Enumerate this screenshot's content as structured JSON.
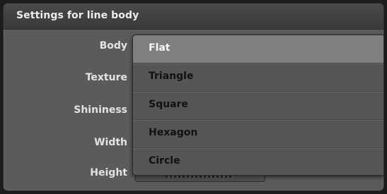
{
  "panel": {
    "title": "Settings for line body",
    "labels": {
      "body": "Body",
      "texture": "Texture",
      "shininess": "Shininess",
      "width": "Width",
      "height": "Height"
    },
    "height_value": "10.00 %"
  },
  "dropdown": {
    "selected": "Flat",
    "options": [
      "Flat",
      "Triangle",
      "Square",
      "Hexagon",
      "Circle"
    ]
  },
  "colors": {
    "panel_bg": "#5b5b5b",
    "titlebar_bg": "#3a3a3a",
    "dropdown_bg": "#565656",
    "selected_bg": "#7f7f7f"
  }
}
